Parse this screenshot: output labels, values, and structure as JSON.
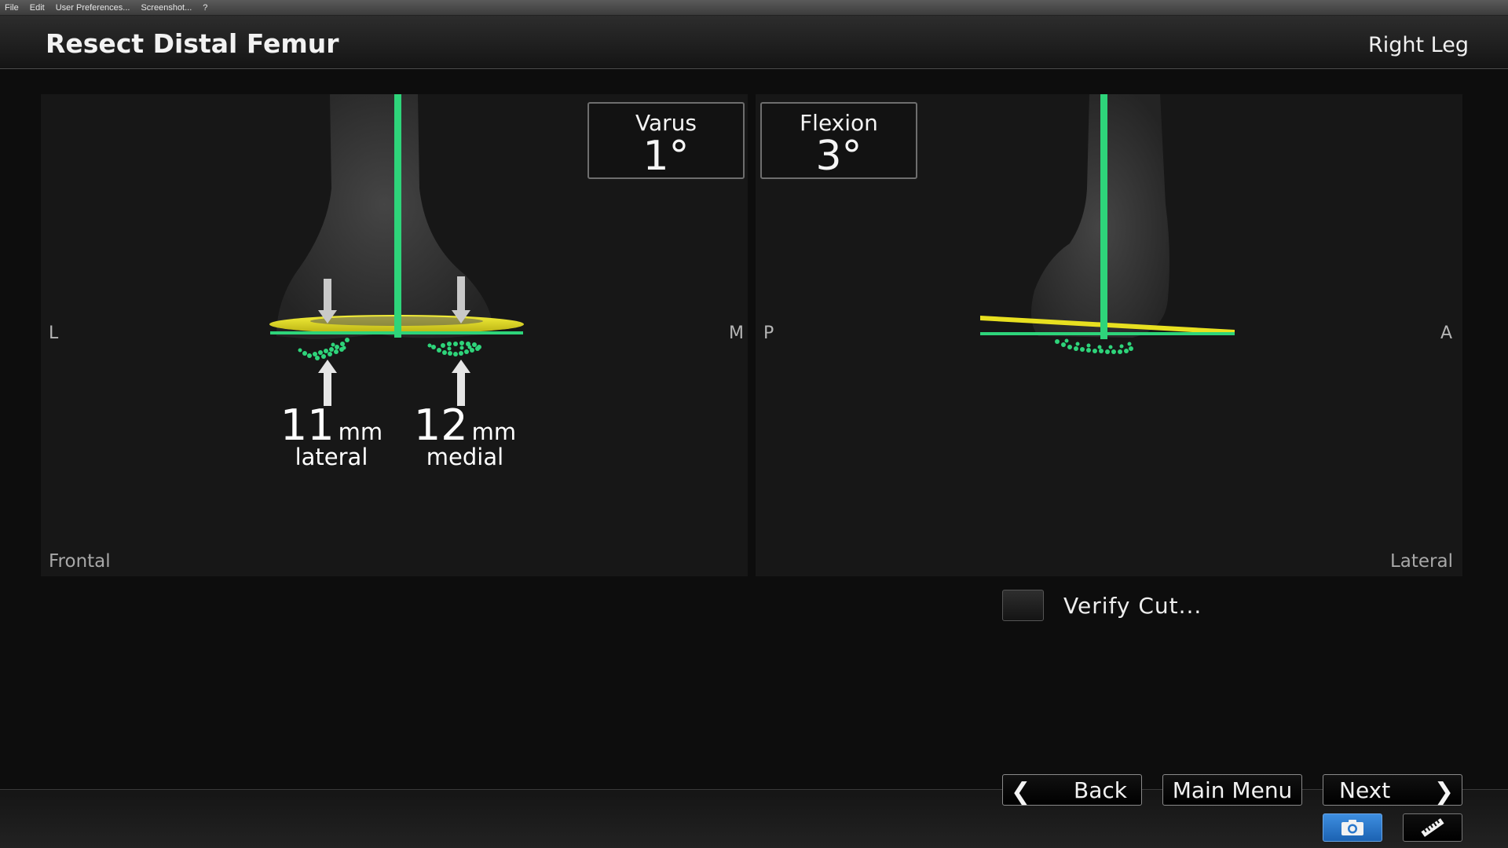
{
  "menu": [
    "File",
    "Edit",
    "User Preferences...",
    "Screenshot...",
    "?"
  ],
  "header": {
    "title": "Resect Distal Femur",
    "leg": "Right Leg"
  },
  "frontal": {
    "view_label": "Frontal",
    "left_axis": "L",
    "right_axis": "M",
    "lateral": {
      "value": "11",
      "unit": "mm",
      "side": "lateral"
    },
    "medial": {
      "value": "12",
      "unit": "mm",
      "side": "medial"
    }
  },
  "sagittal": {
    "view_label": "Lateral",
    "left_axis": "P",
    "right_axis": "A"
  },
  "angles": {
    "varus": {
      "label": "Varus",
      "value": "1°"
    },
    "flexion": {
      "label": "Flexion",
      "value": "3°"
    }
  },
  "verify": {
    "label": "Verify Cut..."
  },
  "nav": {
    "back": "Back",
    "main_menu": "Main Menu",
    "next": "Next"
  },
  "icons": {
    "back": "chevron-left-icon",
    "next": "chevron-right-icon",
    "camera": "camera-icon",
    "ruler": "ruler-icon"
  },
  "colors": {
    "accent_green": "#2ed47a",
    "plane_yellow": "#e8e020",
    "camera_blue": "#2a78cc"
  }
}
